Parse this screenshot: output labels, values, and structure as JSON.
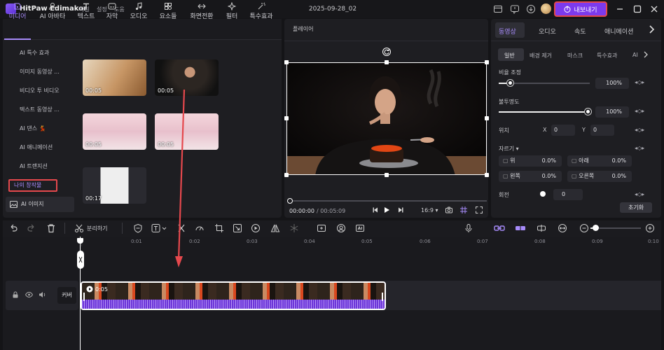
{
  "app": {
    "name": "HitPaw Edimakor",
    "menus": [
      "파일",
      "설정",
      "도움"
    ],
    "project_title": "2025-09-28_02",
    "export_label": "내보내기"
  },
  "media_tabs": [
    {
      "label": "미디어",
      "icon": "media-icon"
    },
    {
      "label": "AI 아바타",
      "icon": "avatar-icon"
    },
    {
      "label": "텍스트",
      "icon": "text-icon"
    },
    {
      "label": "자막",
      "icon": "subtitle-icon"
    },
    {
      "label": "오디오",
      "icon": "music-icon"
    },
    {
      "label": "요소들",
      "icon": "elements-icon"
    },
    {
      "label": "화면전환",
      "icon": "transition-icon"
    },
    {
      "label": "필터",
      "icon": "filter-icon"
    },
    {
      "label": "특수효과",
      "icon": "effects-icon"
    }
  ],
  "sidebar": {
    "items": [
      "AI 특수 효과",
      "이미지 동영상 ...",
      "비디오 투 비디오",
      "텍스트 동영상 ...",
      "AI 댄스 💃",
      "AI 애니메이션",
      "AI 트랜지션"
    ],
    "my_creations": "나의 창작물",
    "ai_image": "AI 이미지"
  },
  "media_items": [
    {
      "duration": "00:05",
      "kind": "cake-hands"
    },
    {
      "duration": "00:05",
      "kind": "woman-eating"
    },
    {
      "duration": "00:05",
      "kind": "anime-girl"
    },
    {
      "duration": "00:05",
      "kind": "anime-girl"
    },
    {
      "duration": "00:17",
      "kind": "schoolgirl"
    }
  ],
  "player": {
    "label": "플레이어",
    "time_current": "00:00:00",
    "time_total": "/ 00:05:09",
    "aspect": "16:9",
    "progress": 0
  },
  "properties": {
    "tabs": [
      "동영상",
      "오디오",
      "속도",
      "애니메이션"
    ],
    "subtabs": [
      "일반",
      "배경 제거",
      "마스크",
      "특수효과",
      "AI"
    ],
    "scale_label": "비율 조정",
    "scale_value": "100%",
    "scale_level": 0.12,
    "opacity_label": "불투명도",
    "opacity_value": "100%",
    "opacity_level": 1.0,
    "position_label": "위치",
    "pos_x_label": "X",
    "pos_x": "0",
    "pos_y_label": "Y",
    "pos_y": "0",
    "crop_label": "자르기",
    "crop_top_label": "위",
    "crop_top": "0.0%",
    "crop_bottom_label": "아래",
    "crop_bottom": "0.0%",
    "crop_left_label": "왼쪽",
    "crop_left": "0.0%",
    "crop_right_label": "오른쪽",
    "crop_right": "0.0%",
    "rotate_label": "회전",
    "rotate_value": "0",
    "reset_label": "초기화"
  },
  "toolbar": {
    "split_label": "분리하기"
  },
  "timeline": {
    "ruler": [
      "0:01",
      "0:02",
      "0:03",
      "0:04",
      "0:05",
      "0:06",
      "0:07",
      "0:08",
      "0:09",
      "0:10"
    ],
    "cover_label": "커버",
    "clip_duration": "0:05"
  },
  "colors": {
    "accent": "#7c3aed",
    "highlight": "#e5484d",
    "annotation_arrow": "#e5484d"
  }
}
